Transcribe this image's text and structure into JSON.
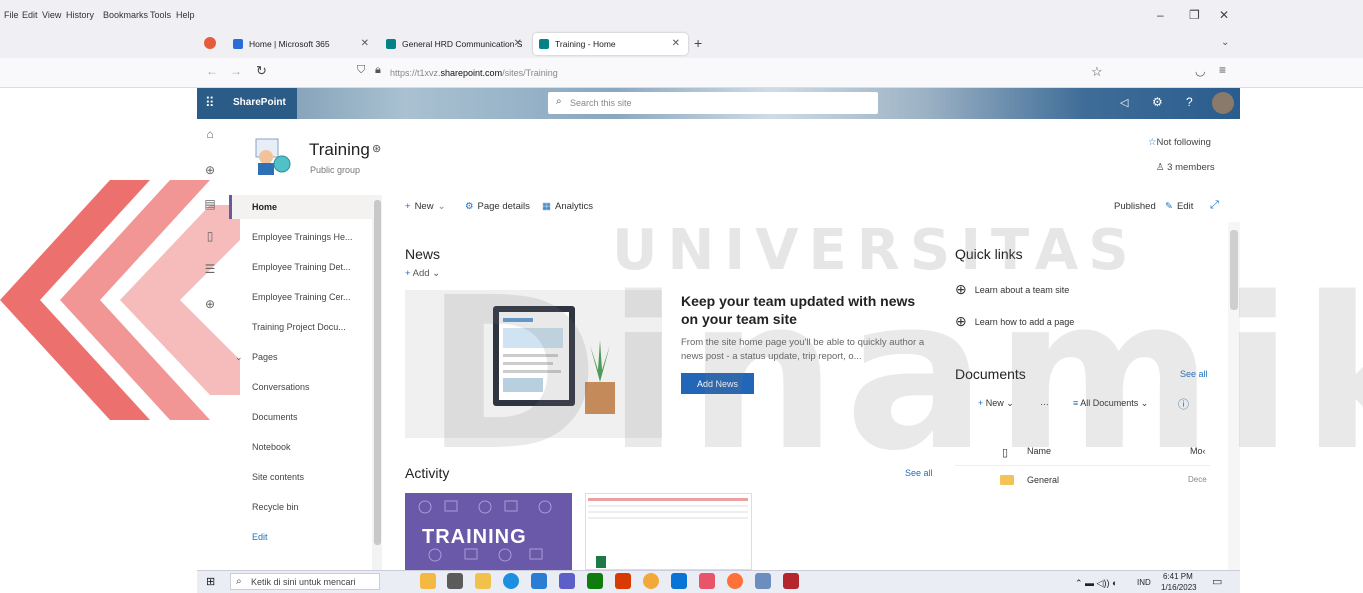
{
  "browser": {
    "menu": [
      "File",
      "Edit",
      "View",
      "History",
      "Bookmarks",
      "Tools",
      "Help"
    ],
    "window_controls": {
      "minimize": "–",
      "restore": "❐",
      "close": "✕"
    },
    "tabs": [
      {
        "label": "Home | Microsoft 365",
        "color": "#2b6cd8"
      },
      {
        "label": "General HRD Communication S",
        "color": "#038387"
      },
      {
        "label": "Training - Home",
        "color": "#038387"
      }
    ],
    "new_tab": "+",
    "tab_list": "⌄",
    "url_prefix": "https://t1xvz.",
    "url_host": "sharepoint.com",
    "url_path": "/sites/Training"
  },
  "suite": {
    "app_name": "SharePoint",
    "search_placeholder": "Search this site"
  },
  "site": {
    "title": "Training",
    "subtitle": "Public group",
    "following": "Not following",
    "members": "3 members"
  },
  "leftnav": {
    "items": [
      "Home",
      "Employee Trainings He...",
      "Employee Training Det...",
      "Employee Training Cer...",
      "Training Project Docu...",
      "Pages",
      "Conversations",
      "Documents",
      "Notebook",
      "Site contents",
      "Recycle bin",
      "Edit"
    ]
  },
  "cmdbar": {
    "new": "New",
    "page_details": "Page details",
    "analytics": "Analytics",
    "published": "Published",
    "edit": "Edit"
  },
  "news": {
    "title": "News",
    "add": "Add",
    "headline": "Keep your team updated with news on your team site",
    "body": "From the site home page you'll be able to quickly author a news post - a status update, trip report, o...",
    "button": "Add News"
  },
  "activity": {
    "title": "Activity",
    "see_all": "See all",
    "card_text": "TRAINING"
  },
  "quicklinks": {
    "title": "Quick links",
    "items": [
      "Learn about a team site",
      "Learn how to add a page"
    ]
  },
  "documents": {
    "title": "Documents",
    "see_all": "See all",
    "new": "New",
    "more": "…",
    "view": "All Documents",
    "col_name": "Name",
    "col_modified": "Mo‹",
    "rows": [
      {
        "name": "General",
        "modified": "Dece"
      }
    ]
  },
  "watermark": {
    "word1": "UNIVERSITAS",
    "word2": "Dinamika",
    "color": "#e5403e"
  },
  "taskbar": {
    "search_placeholder": "Ketik di sini untuk mencari",
    "lang": "IND",
    "time": "6:41 PM",
    "date": "1/16/2023"
  }
}
